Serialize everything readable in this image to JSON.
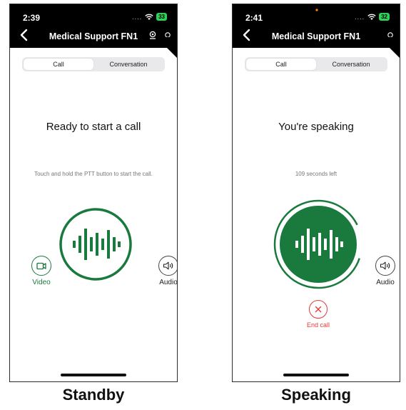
{
  "standby": {
    "status_time": "2:39",
    "battery": "33",
    "nav_title": "Medical Support FN1",
    "tabs": [
      "Call",
      "Conversation"
    ],
    "headline": "Ready to start a call",
    "instruction": "Touch and hold the PTT button to start the call.",
    "video_label": "Video",
    "audio_label": "Audio",
    "caption": "Standby"
  },
  "speaking": {
    "status_time": "2:41",
    "battery": "32",
    "nav_title": "Medical Support FN1",
    "tabs": [
      "Call",
      "Conversation"
    ],
    "headline": "You're speaking",
    "timer": "109 seconds left",
    "audio_label": "Audio",
    "end_call_label": "End call",
    "caption": "Speaking"
  },
  "colors": {
    "accent_green": "#1a7a3e",
    "end_call_red": "#e53935",
    "header_black": "#000000"
  },
  "icons": {
    "back": "chevron-left-icon",
    "wifi": "wifi-icon",
    "video": "video-camera-icon",
    "audio": "speaker-icon",
    "ptt": "voice-waveform-icon",
    "end_call": "close-x-icon"
  }
}
